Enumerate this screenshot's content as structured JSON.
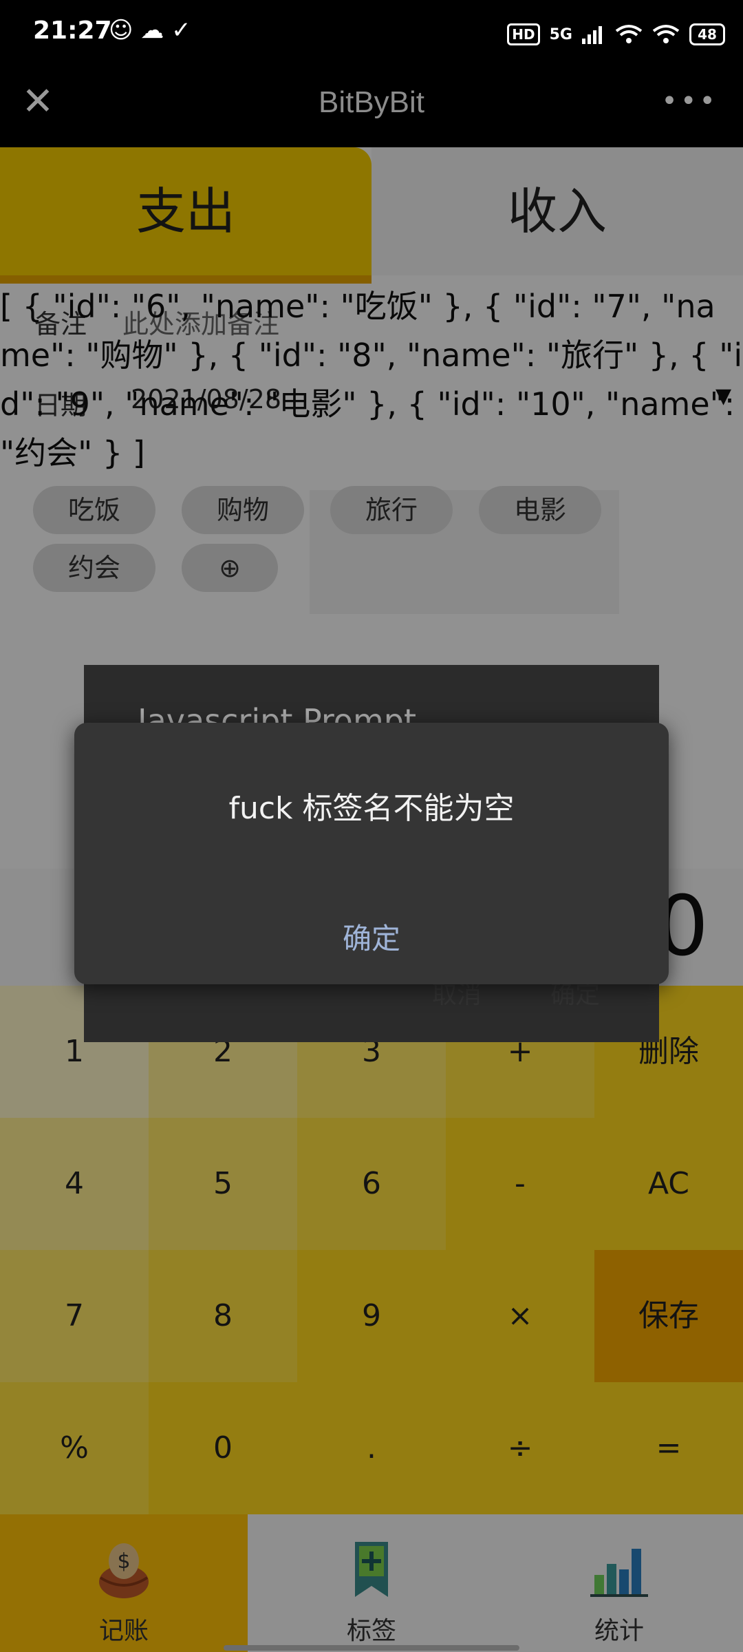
{
  "status_bar": {
    "time": "21:27",
    "left_icons": [
      "ghost-icon",
      "cloud-icon",
      "check-icon"
    ],
    "hd": "HD",
    "network": "5G",
    "battery": "48"
  },
  "header": {
    "close_symbol": "✕",
    "title": "BitByBit",
    "more_symbol": "•••"
  },
  "tabs": {
    "expense": "支出",
    "income": "收入"
  },
  "json_dump": "[ { \"id\": \"6\", \"name\": \"吃饭\" }, { \"id\": \"7\", \"name\": \"购物\" }, { \"id\": \"8\", \"name\": \"旅行\" }, { \"id\": \"9\", \"name\": \"电影\" }, { \"id\": \"10\", \"name\": \"约会\" } ]",
  "form": {
    "note_label": "备注",
    "note_placeholder": "此处添加备注",
    "date_label": "日期",
    "date_value": "2021/08/28",
    "dropdown_symbol": "▼"
  },
  "tags": [
    "吃饭",
    "购物",
    "旅行",
    "电影",
    "约会",
    "⊕"
  ],
  "amount": "0",
  "keypad": [
    [
      "1",
      "2",
      "3",
      "+",
      "删除"
    ],
    [
      "4",
      "5",
      "6",
      "-",
      "AC"
    ],
    [
      "7",
      "8",
      "9",
      "×",
      "保存"
    ],
    [
      "%",
      "0",
      ".",
      "÷",
      "="
    ]
  ],
  "nav": {
    "items": [
      {
        "label": "记账",
        "icon": "money-bag-icon"
      },
      {
        "label": "标签",
        "icon": "bookmark-plus-icon"
      },
      {
        "label": "统计",
        "icon": "bar-chart-icon"
      }
    ]
  },
  "prompt": {
    "title": "Javascript Prompt",
    "cancel": "取消",
    "ok": "确定"
  },
  "alert": {
    "message": "fuck 标签名不能为空",
    "ok": "确定"
  },
  "colors": {
    "accent_yellow": "#f5cc00",
    "save_orange": "#f5a800",
    "nav_active": "#ffc107"
  }
}
